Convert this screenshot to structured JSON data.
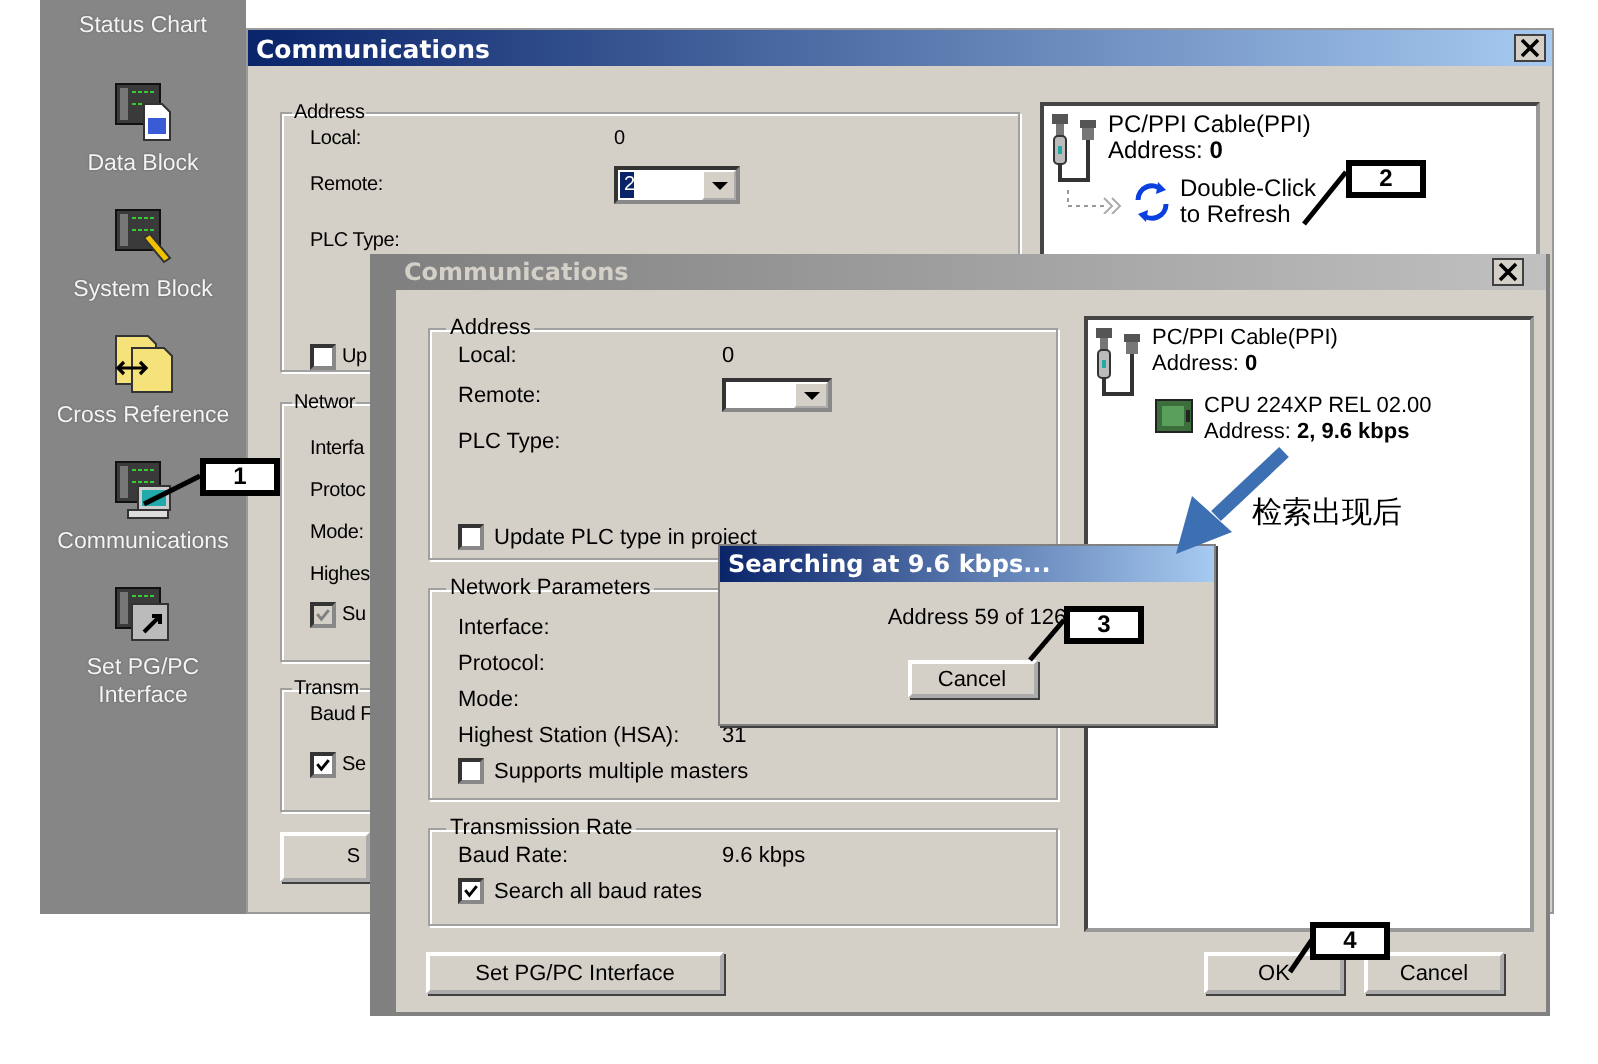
{
  "sidebar": {
    "items": [
      {
        "label": "Status Chart"
      },
      {
        "label": "Data Block",
        "kind": "data_block"
      },
      {
        "label": "System Block",
        "kind": "system_block"
      },
      {
        "label": "Cross Reference",
        "kind": "cross_reference"
      },
      {
        "label": "Communications",
        "kind": "communications"
      },
      {
        "label": "Set PG/PC Interface",
        "kind": "set_pgpc"
      }
    ]
  },
  "back_window": {
    "title": "Communications",
    "active": true,
    "address": {
      "title": "Address",
      "local_label": "Local:",
      "local_value": "0",
      "remote_label": "Remote:",
      "remote_value": "2",
      "remote_value_selected": true,
      "plc_type_label": "PLC Type:",
      "checkbox": {
        "label": "Up",
        "checked": false,
        "disabled": false
      }
    },
    "network": {
      "title": "Networ",
      "rows": [
        {
          "label": "Interfa"
        },
        {
          "label": "Protoc"
        },
        {
          "label": "Mode:"
        },
        {
          "label": "Highes"
        }
      ],
      "checkbox": {
        "label": "Su",
        "checked": true,
        "disabled": true
      }
    },
    "transmission": {
      "title": "Transm",
      "rows": [
        {
          "label": "Baud F"
        }
      ],
      "checkbox": {
        "label": "Se",
        "checked": true,
        "disabled": false
      }
    },
    "button": "S",
    "device_panel": {
      "cable_label": "PC/PPI Cable(PPI)",
      "cable_address": "Address: **0**",
      "refresh_lines": [
        "Double-Click",
        "to Refresh"
      ]
    }
  },
  "front_window": {
    "title": "Communications",
    "active": false,
    "address": {
      "title": "Address",
      "local_label": "Local:",
      "local_value": "0",
      "remote_label": "Remote:",
      "plc_type_label": "PLC Type:",
      "checkbox": {
        "label": "Update PLC type in project",
        "checked": false,
        "disabled": false
      }
    },
    "network": {
      "title": "Network Parameters",
      "rows": [
        {
          "label": "Interface:"
        },
        {
          "label": "Protocol:"
        },
        {
          "label": "Mode:"
        },
        {
          "label": "Highest Station (HSA):",
          "value": "31"
        }
      ],
      "checkbox": {
        "label": "Supports multiple masters",
        "checked": false,
        "disabled": false
      }
    },
    "transmission": {
      "title": "Transmission Rate",
      "rows": [
        {
          "label": "Baud Rate:",
          "value": "9.6 kbps"
        }
      ],
      "checkbox": {
        "label": "Search all baud rates",
        "checked": true,
        "disabled": false
      }
    },
    "button": "Set PG/PC Interface",
    "device_panel": {
      "cable_label": "PC/PPI Cable(PPI)",
      "cable_address": "Address: **0**",
      "plc_lines": [
        "CPU 224XP REL 02.00",
        "Address: **2, 9.6 kbps**"
      ]
    },
    "ok_button": "OK",
    "cancel_button": "Cancel"
  },
  "search_dialog": {
    "title": "Searching at 9.6 kbps...",
    "active": true,
    "message": "Address 59 of 126",
    "button": "Cancel"
  },
  "annotations": {
    "callouts": [
      {
        "number": "1"
      },
      {
        "number": "2"
      },
      {
        "number": "3"
      },
      {
        "number": "4"
      }
    ],
    "note": "检索出现后"
  }
}
